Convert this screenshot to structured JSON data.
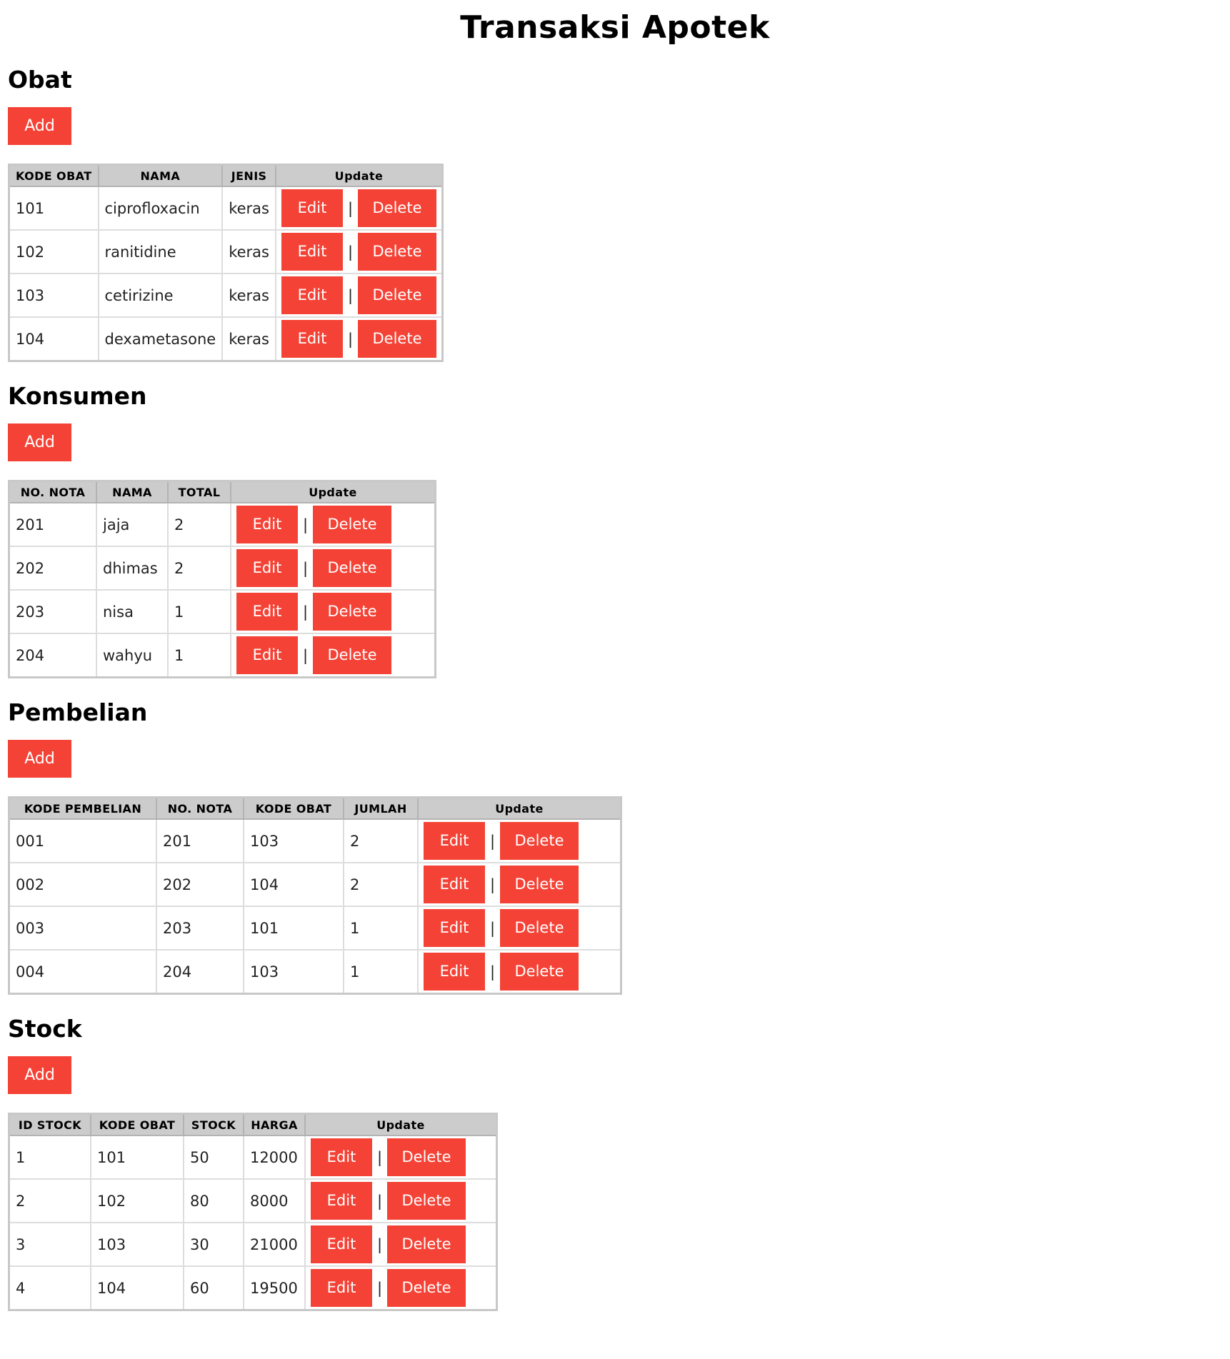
{
  "page": {
    "title": "Transaksi Apotek"
  },
  "labels": {
    "add": "Add",
    "edit": "Edit",
    "delete": "Delete",
    "separator": "|"
  },
  "colors": {
    "button_bg": "#f44336",
    "button_text": "#ffffff",
    "header_bg": "#cccccc",
    "border": "#dddddd"
  },
  "sections": [
    {
      "id": "obat",
      "title": "Obat",
      "columns": [
        "KODE OBAT",
        "NAMA",
        "JENIS",
        "Update"
      ],
      "rows": [
        [
          "101",
          "ciprofloxacin",
          "keras"
        ],
        [
          "102",
          "ranitidine",
          "keras"
        ],
        [
          "103",
          "cetirizine",
          "keras"
        ],
        [
          "104",
          "dexametasone",
          "keras"
        ]
      ]
    },
    {
      "id": "konsumen",
      "title": "Konsumen",
      "columns": [
        "NO. NOTA",
        "NAMA",
        "TOTAL",
        "Update"
      ],
      "rows": [
        [
          "201",
          "jaja",
          "2"
        ],
        [
          "202",
          "dhimas",
          "2"
        ],
        [
          "203",
          "nisa",
          "1"
        ],
        [
          "204",
          "wahyu",
          "1"
        ]
      ]
    },
    {
      "id": "pembelian",
      "title": "Pembelian",
      "columns": [
        "KODE PEMBELIAN",
        "NO. NOTA",
        "KODE OBAT",
        "JUMLAH",
        "Update"
      ],
      "rows": [
        [
          "001",
          "201",
          "103",
          "2"
        ],
        [
          "002",
          "202",
          "104",
          "2"
        ],
        [
          "003",
          "203",
          "101",
          "1"
        ],
        [
          "004",
          "204",
          "103",
          "1"
        ]
      ]
    },
    {
      "id": "stock",
      "title": "Stock",
      "columns": [
        "ID STOCK",
        "KODE OBAT",
        "STOCK",
        "HARGA",
        "Update"
      ],
      "rows": [
        [
          "1",
          "101",
          "50",
          "12000"
        ],
        [
          "2",
          "102",
          "80",
          "8000"
        ],
        [
          "3",
          "103",
          "30",
          "21000"
        ],
        [
          "4",
          "104",
          "60",
          "19500"
        ]
      ]
    }
  ]
}
